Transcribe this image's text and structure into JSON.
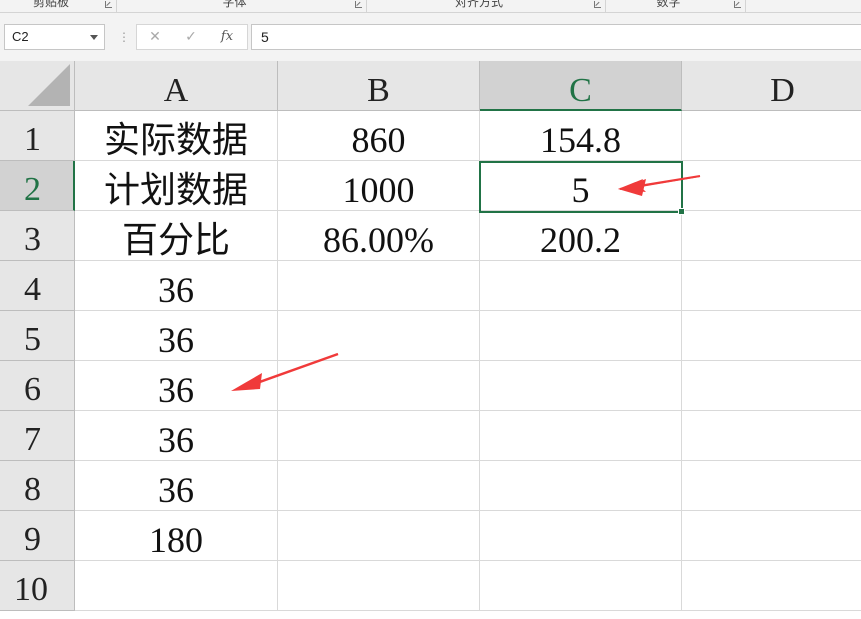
{
  "ribbon": {
    "groups": [
      "剪贴板",
      "字体",
      "对齐方式",
      "数字"
    ]
  },
  "formula_bar": {
    "name_box": "C2",
    "cancel_icon": "close-icon",
    "enter_icon": "check-icon",
    "fx_label": "fx",
    "value": "5"
  },
  "sheet": {
    "columns": [
      "A",
      "B",
      "C",
      "D"
    ],
    "rows": [
      "1",
      "2",
      "3",
      "4",
      "5",
      "6",
      "7",
      "8",
      "9",
      "10"
    ],
    "cells": [
      [
        "实际数据",
        "860",
        "154.8",
        ""
      ],
      [
        "计划数据",
        "1000",
        "5",
        ""
      ],
      [
        "百分比",
        "86.00%",
        "200.2",
        ""
      ],
      [
        "36",
        "",
        "",
        ""
      ],
      [
        "36",
        "",
        "",
        ""
      ],
      [
        "36",
        "",
        "",
        ""
      ],
      [
        "36",
        "",
        "",
        ""
      ],
      [
        "36",
        "",
        "",
        ""
      ],
      [
        "180",
        "",
        "",
        ""
      ],
      [
        "",
        "",
        "",
        ""
      ]
    ],
    "selected_cell": "C2"
  },
  "colors": {
    "accent": "#217346",
    "annotation": "#f03a3a",
    "header_bg": "#e6e6e6",
    "gridline": "#d9d9d9"
  }
}
